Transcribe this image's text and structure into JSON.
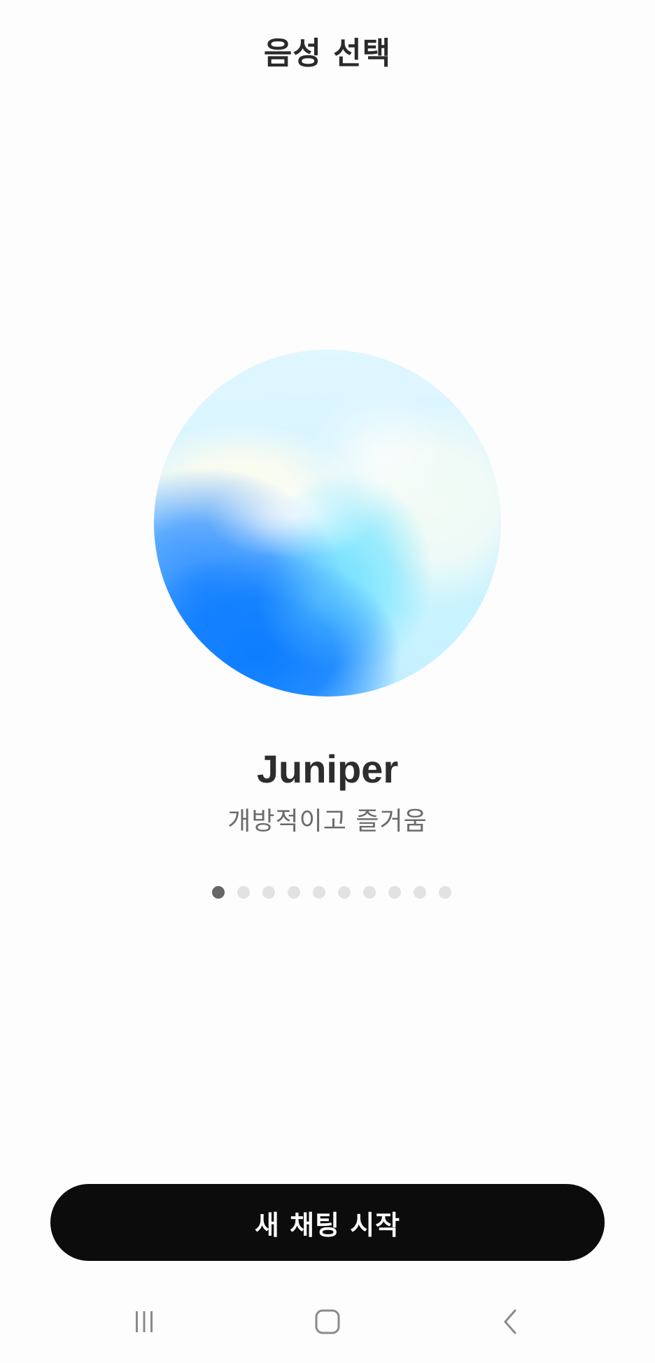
{
  "header": {
    "title": "음성 선택"
  },
  "voice": {
    "name": "Juniper",
    "description": "개방적이고 즐거움",
    "orb_colors": [
      "#dff7ff",
      "#0d7dff",
      "#7fe6ff",
      "#fbfcf0"
    ]
  },
  "pager": {
    "total": 10,
    "active_index": 0,
    "active_color": "#666666",
    "inactive_color": "#e2e2e2"
  },
  "actions": {
    "start_chat_label": "새 채팅 시작"
  },
  "navbar": {
    "recent_icon": "recent-apps-icon",
    "home_icon": "home-icon",
    "back_icon": "back-icon"
  }
}
